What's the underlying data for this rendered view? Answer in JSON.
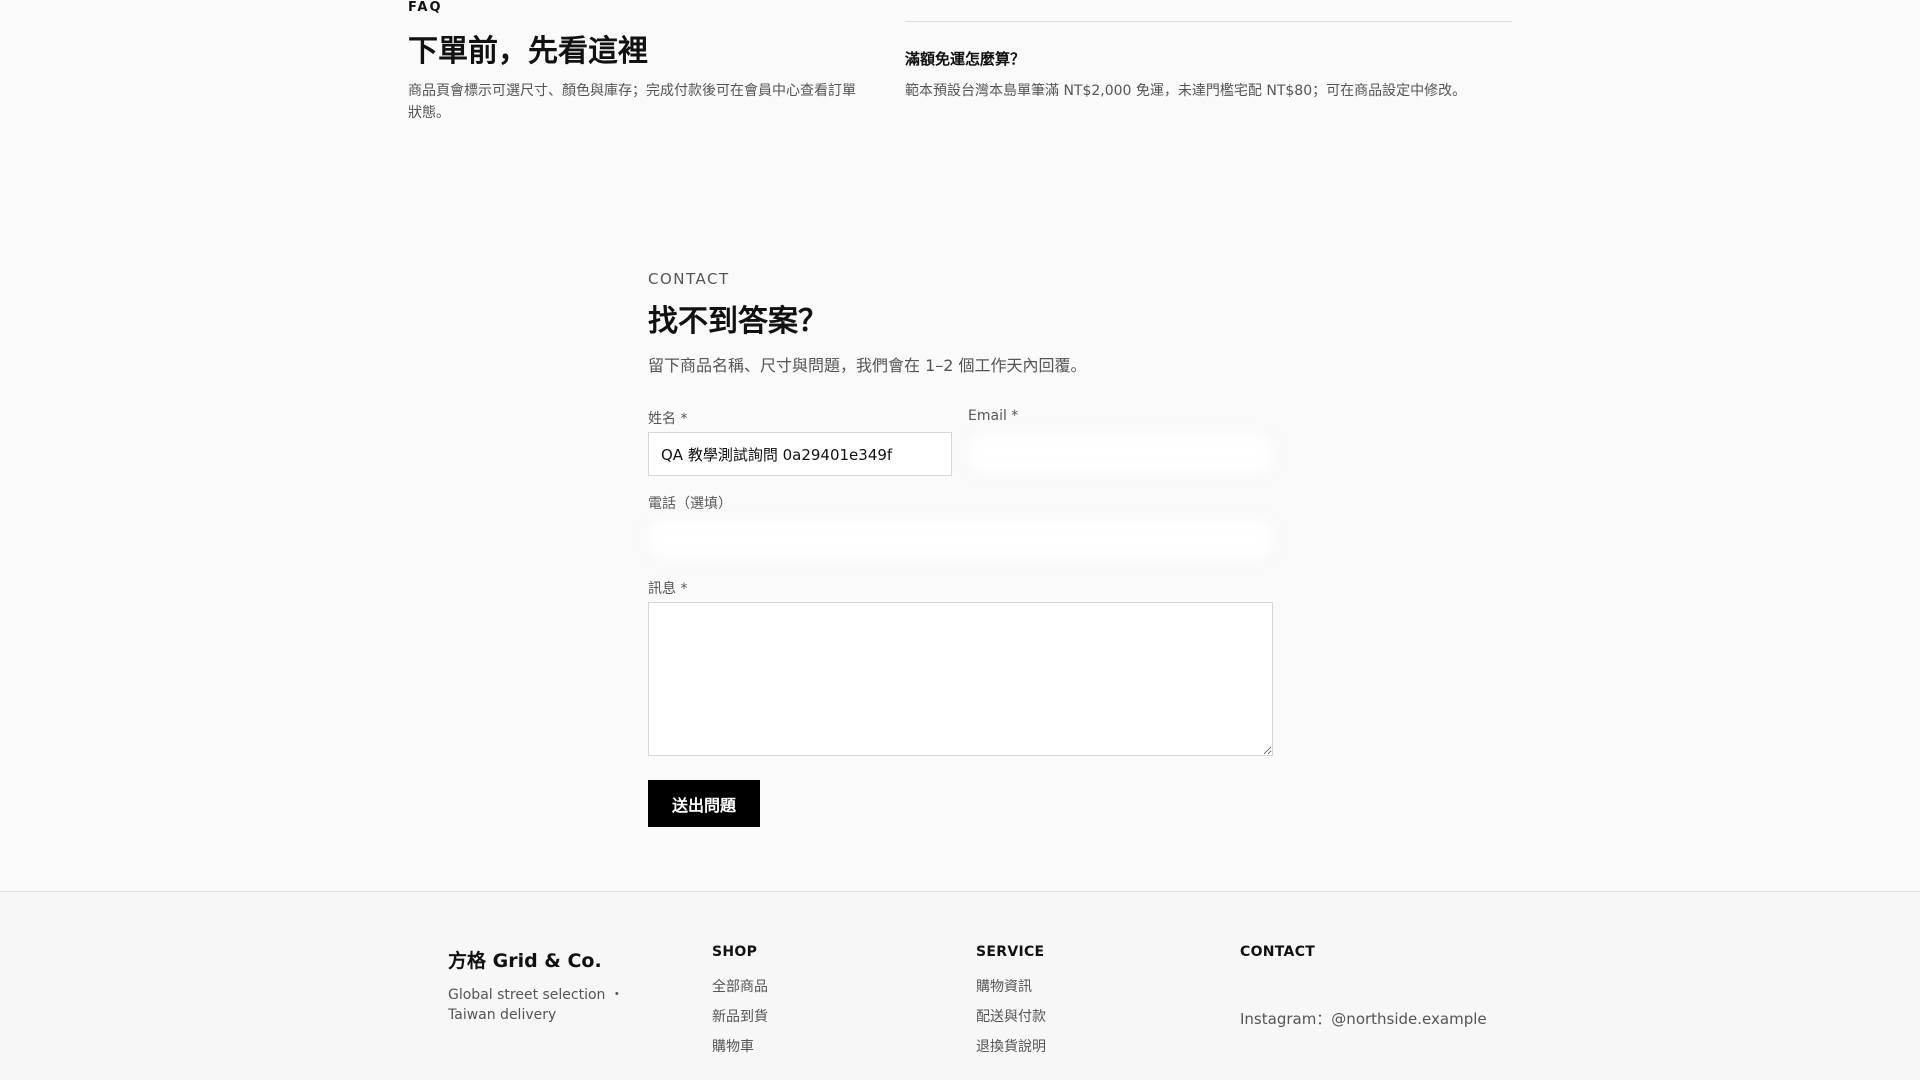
{
  "faq": {
    "eyebrow": "FAQ",
    "title": "下單前，先看這裡",
    "description": "商品頁會標示可選尺寸、顏色與庫存；完成付款後可在會員中心查看訂單狀態。",
    "item": {
      "question": "滿額免運怎麼算？",
      "answer": "範本預設台灣本島單筆滿 NT$2,000 免運，未達門檻宅配 NT$80；可在商品設定中修改。"
    }
  },
  "contact": {
    "eyebrow": "CONTACT",
    "title": "找不到答案？",
    "description": "留下商品名稱、尺寸與問題，我們會在 1–2 個工作天內回覆。",
    "form": {
      "name_label": "姓名 *",
      "name_value": "QA 教學測試詢問 0a29401e349f",
      "email_label": "Email *",
      "email_value": "",
      "phone_label": "電話（選填）",
      "phone_value": "",
      "message_label": "訊息 *",
      "message_value": "",
      "submit_label": "送出問題"
    }
  },
  "footer": {
    "brand": {
      "name": "方格 Grid & Co.",
      "tagline": "Global street selection ・ Taiwan delivery"
    },
    "shop": {
      "heading": "SHOP",
      "links": [
        "全部商品",
        "新品到貨",
        "購物車"
      ]
    },
    "service": {
      "heading": "SERVICE",
      "links": [
        "購物資訊",
        "配送與付款",
        "退換貨說明"
      ]
    },
    "contact": {
      "heading": "CONTACT",
      "instagram": "Instagram：@northside.example"
    }
  },
  "colors": {
    "background": "#fafafa",
    "button": "#000000",
    "button_text": "#ffffff",
    "muted_text": "#555555"
  }
}
